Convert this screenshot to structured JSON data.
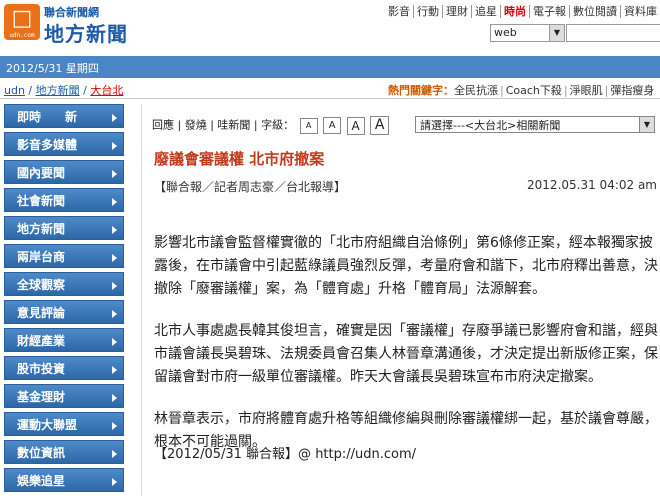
{
  "header": {
    "logo_glyph": "□",
    "logo_url": "udn.com",
    "logo_top": "聯合新聞網",
    "logo_main": "地方新聞",
    "topnav": [
      "影音",
      "行動",
      "理財",
      "追星",
      "時尚",
      "電子報",
      "數位閱讀",
      "資料庫"
    ],
    "hot_index": 4,
    "search_select": "web",
    "search_value": ""
  },
  "datebar": {
    "date": "2012/5/31 星期四"
  },
  "breadcrumb": [
    "udn",
    "地方新聞",
    "大台北"
  ],
  "hot_keywords": {
    "label": "熱門關鍵字：",
    "items": [
      "全民抗漲",
      "Coach下殺",
      "淨眼肌",
      "彈指瘦身"
    ]
  },
  "sidebar": {
    "items": [
      "即時　　新",
      "影音多媒體",
      "國內要聞",
      "社會新聞",
      "地方新聞",
      "兩岸台商",
      "全球觀察",
      "意見評論",
      "財經產業",
      "股市投資",
      "基金理財",
      "運動大聯盟",
      "數位資訊",
      "娛樂追星"
    ]
  },
  "toolbar": {
    "comment": "回應",
    "push": "發燒",
    "hemi": "哇新聞",
    "fontsize_label": "字級：",
    "sizes": [
      "A",
      "A",
      "A",
      "A"
    ],
    "related_select": "請選擇---<大台北>相關新聞"
  },
  "article": {
    "title": "廢議會審議權 北市府撤案",
    "byline": "【聯合報／記者周志豪／台北報導】",
    "timestamp": "2012.05.31 04:02 am",
    "p1": "影響北市議會監督權實徹的「北市府組織自治條例」第6條修正案，經本報獨家披露後，在市議會中引起藍綠議員強烈反彈，考量府會和諧下，北市府釋出善意，決撤除「廢審議權」案，為「體育處」升格「體育局」法源解套。",
    "p2": "北市人事處處長韓其俊坦言，確實是因「審議權」存廢爭議已影響府會和諧，經與市議會議長吳碧珠、法規委員會召集人林晉章溝通後，才決定提出新版修正案，保留議會對市府一級單位審議權。昨天大會議長吳碧珠宣布市府決定撤案。",
    "p3": "林晉章表示，市府將體育處升格等組織修編與刪除審議權綁一起，基於議會尊嚴，根本不可能過關。",
    "signature": "【2012/05/31 聯合報】@ http://udn.com/"
  }
}
